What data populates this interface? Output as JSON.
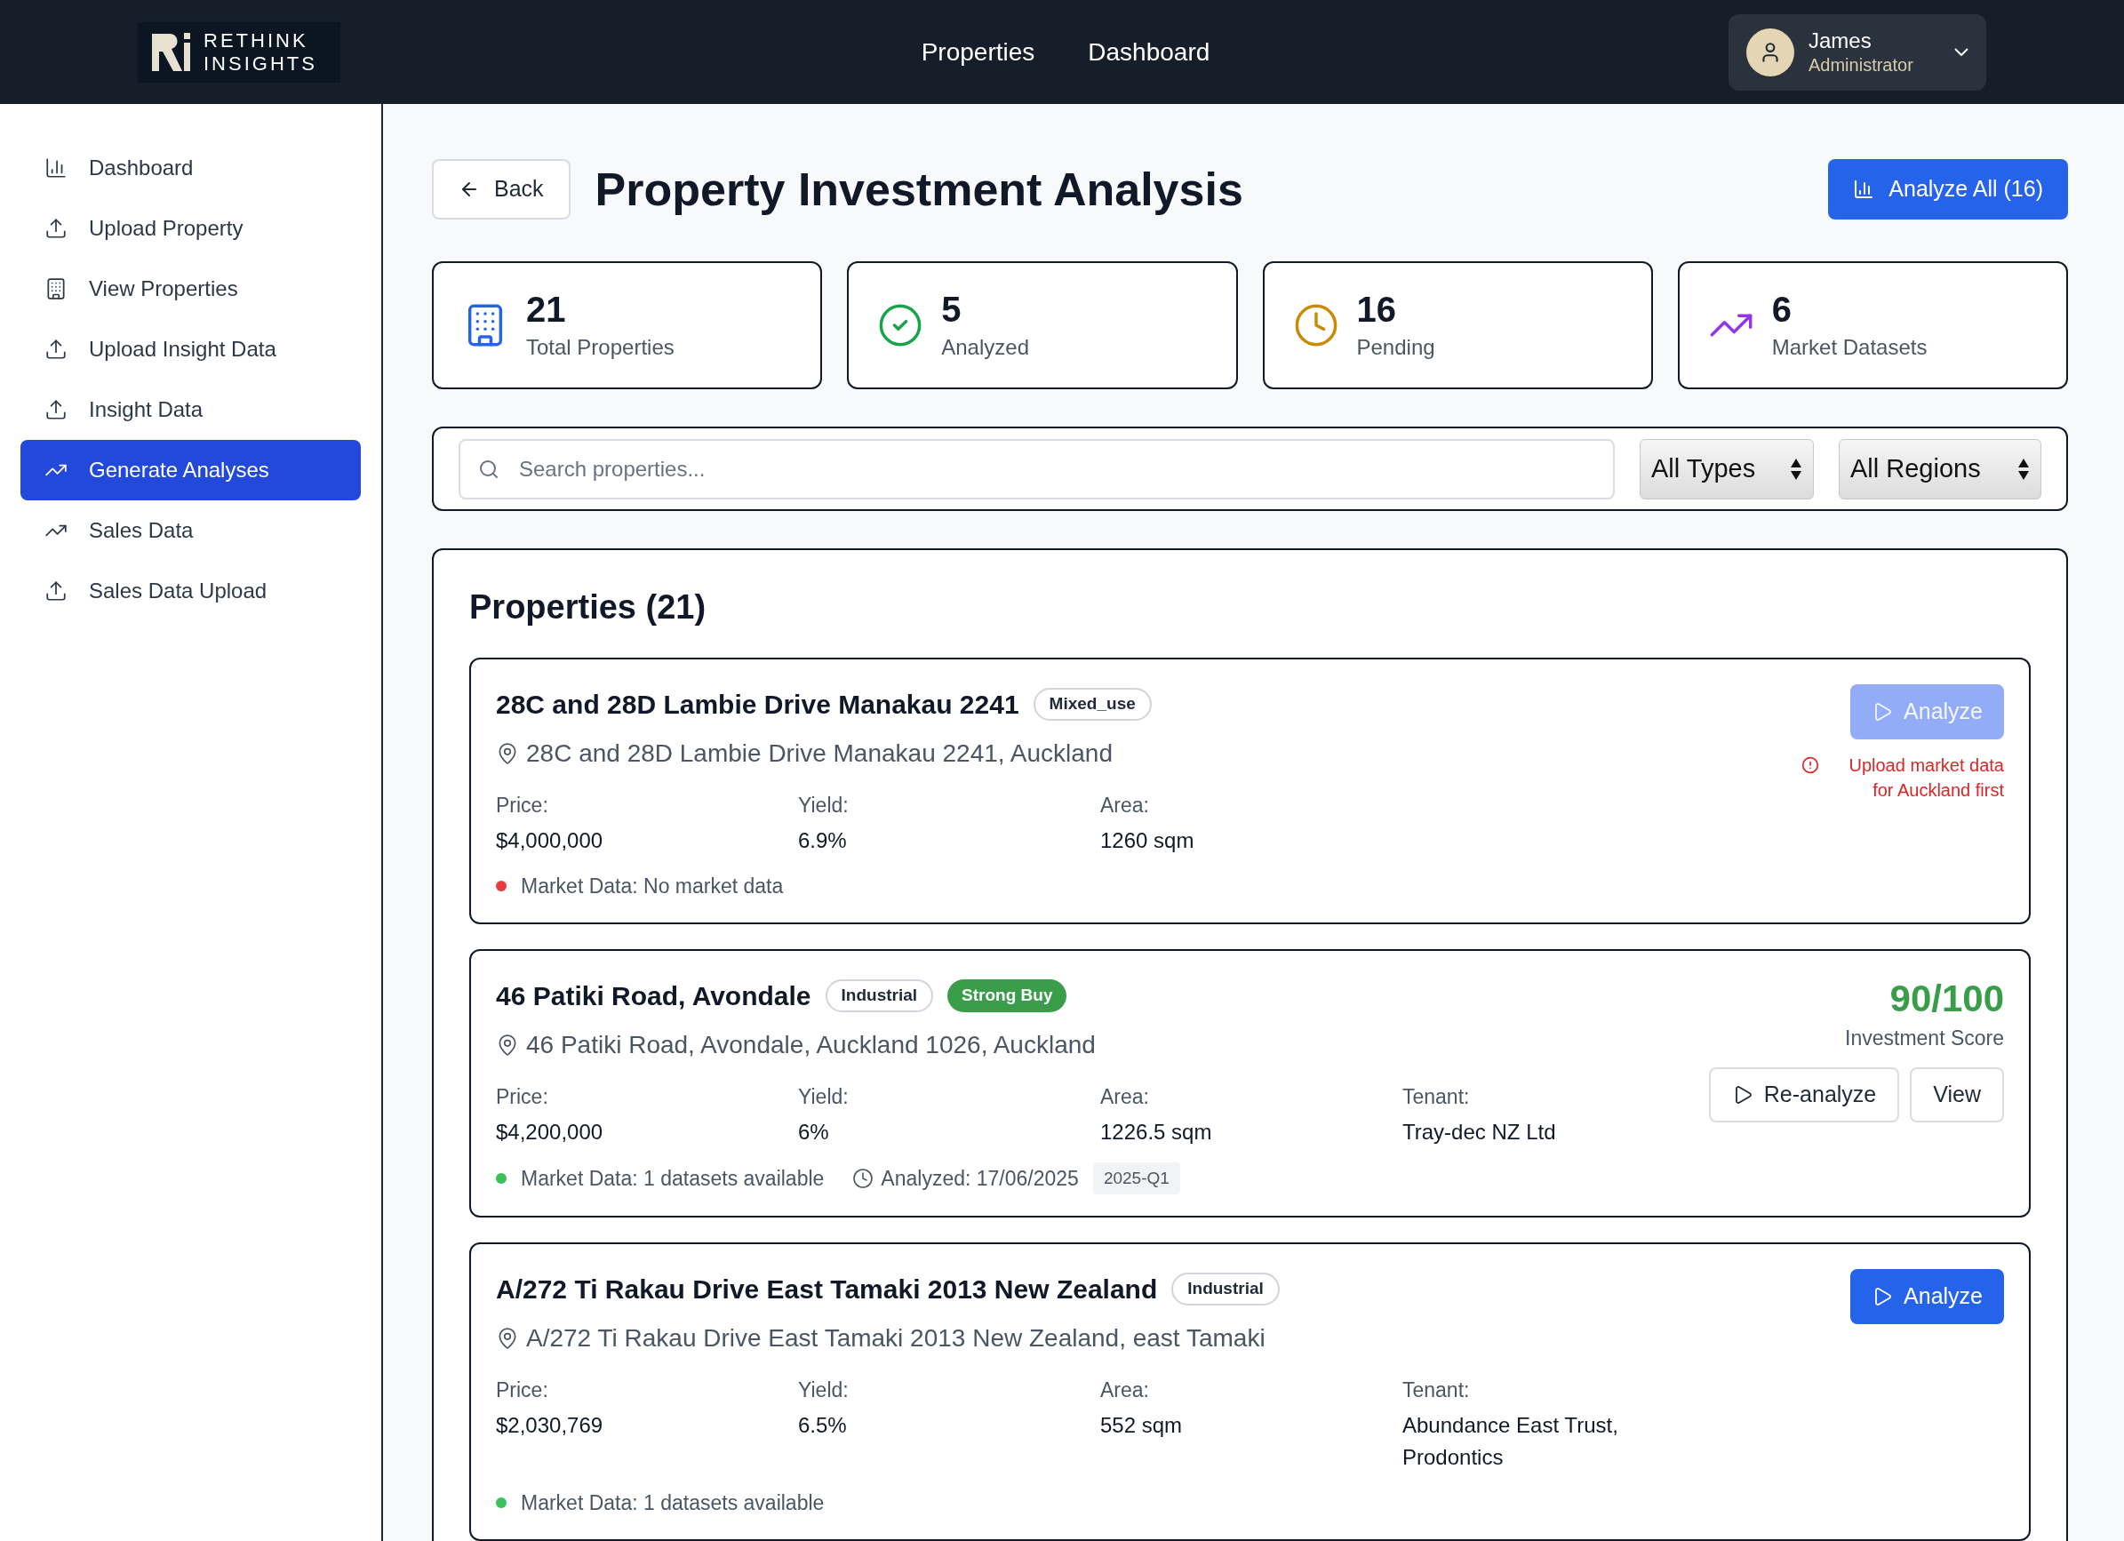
{
  "header": {
    "logo": {
      "line1": "RETHINK",
      "line2": "INSIGHTS"
    },
    "nav": [
      "Properties",
      "Dashboard"
    ],
    "user": {
      "name": "James",
      "role": "Administrator"
    }
  },
  "sidebar": {
    "items": [
      {
        "label": "Dashboard",
        "kind": "chart",
        "selected": false
      },
      {
        "label": "Upload Property",
        "kind": "upload",
        "selected": false
      },
      {
        "label": "View Properties",
        "kind": "building",
        "selected": false
      },
      {
        "label": "Upload Insight Data",
        "kind": "upload",
        "selected": false
      },
      {
        "label": "Insight Data",
        "kind": "upload",
        "selected": false
      },
      {
        "label": "Generate Analyses",
        "kind": "trend",
        "selected": true
      },
      {
        "label": "Sales Data",
        "kind": "trend",
        "selected": false
      },
      {
        "label": "Sales Data Upload",
        "kind": "upload",
        "selected": false
      }
    ]
  },
  "page": {
    "back": "Back",
    "title": "Property Investment Analysis",
    "analyze_all": "Analyze All (16)"
  },
  "stats": [
    {
      "value": "21",
      "label": "Total Properties",
      "kind": "building"
    },
    {
      "value": "5",
      "label": "Analyzed",
      "kind": "check"
    },
    {
      "value": "16",
      "label": "Pending",
      "kind": "clock"
    },
    {
      "value": "6",
      "label": "Market Datasets",
      "kind": "trend"
    }
  ],
  "filters": {
    "search": {
      "placeholder": "Search properties..."
    },
    "selects": [
      "All Types",
      "All Regions"
    ]
  },
  "properties": {
    "heading": "Properties (21)",
    "items": [
      {
        "title": "28C and 28D Lambie Drive Manakau 2241",
        "type": "Mixed_use",
        "address": "28C and 28D Lambie Drive Manakau 2241, Auckland",
        "fields": [
          {
            "label": "Price:",
            "value": "$4,000,000"
          },
          {
            "label": "Yield:",
            "value": "6.9%"
          },
          {
            "label": "Area:",
            "value": "1260 sqm"
          }
        ],
        "market": {
          "text": "Market Data: No market data",
          "color": "#e53e3e"
        },
        "actions": [
          {
            "label": "Analyze",
            "kind": "primary-play",
            "disabled": true
          }
        ],
        "warning": "Upload market data for Auckland first"
      },
      {
        "title": "46 Patiki Road, Avondale",
        "type": "Industrial",
        "recommendation": "Strong Buy",
        "address": "46 Patiki Road, Avondale, Auckland 1026, Auckland",
        "fields": [
          {
            "label": "Price:",
            "value": "$4,200,000"
          },
          {
            "label": "Yield:",
            "value": "6%"
          },
          {
            "label": "Area:",
            "value": "1226.5 sqm"
          },
          {
            "label": "Tenant:",
            "value": "Tray-dec NZ Ltd"
          }
        ],
        "market": {
          "text": "Market Data: 1 datasets available",
          "color": "#3cc05a"
        },
        "analyzed": "Analyzed: 17/06/2025",
        "quarter": "2025-Q1",
        "score": "90/100",
        "score_label": "Investment Score",
        "actions": [
          {
            "label": "Re-analyze",
            "kind": "outline-play",
            "disabled": false
          },
          {
            "label": "View",
            "kind": "outline",
            "disabled": false
          }
        ]
      },
      {
        "title": "A/272 Ti Rakau Drive East Tamaki 2013 New Zealand",
        "type": "Industrial",
        "address": "A/272 Ti Rakau Drive East Tamaki 2013 New Zealand, east Tamaki",
        "fields": [
          {
            "label": "Price:",
            "value": "$2,030,769"
          },
          {
            "label": "Yield:",
            "value": "6.5%"
          },
          {
            "label": "Area:",
            "value": "552 sqm"
          },
          {
            "label": "Tenant:",
            "value": "Abundance East Trust, Prodontics"
          }
        ],
        "market": {
          "text": "Market Data: 1 datasets available",
          "color": "#3cc05a"
        },
        "actions": [
          {
            "label": "Analyze",
            "kind": "primary-play",
            "disabled": false
          }
        ]
      }
    ]
  }
}
